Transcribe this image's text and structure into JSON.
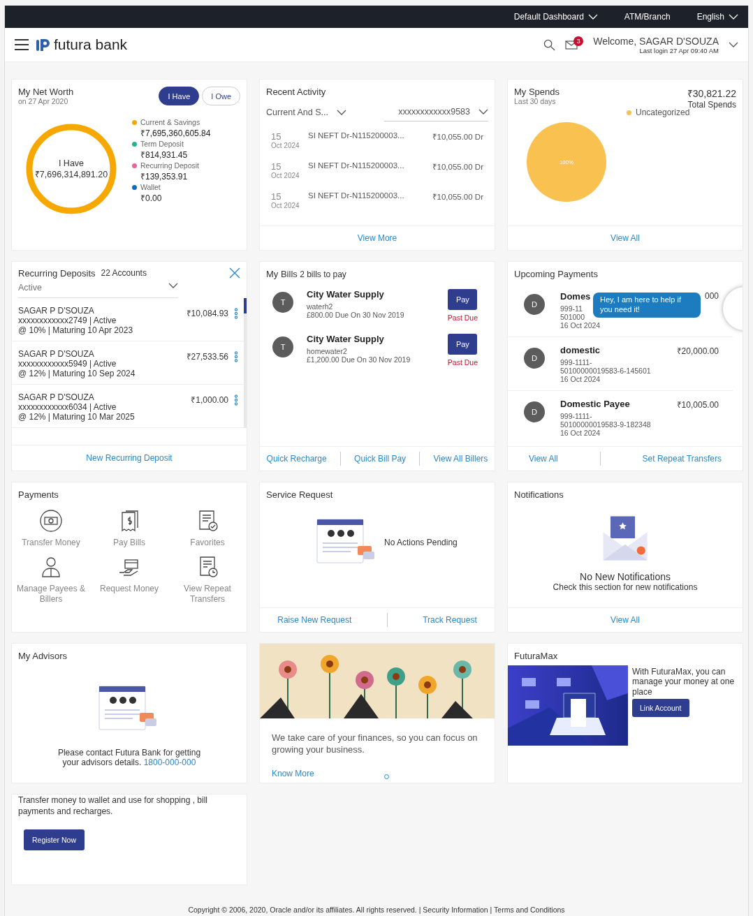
{
  "top_bar": {
    "items": [
      {
        "label": "Default Dashboard",
        "kind": "dropdown"
      },
      {
        "label": "ATM/Branch",
        "kind": "link"
      },
      {
        "label": "English",
        "kind": "dropdown"
      }
    ]
  },
  "header": {
    "brand": "futura bank",
    "notification_count": "3",
    "welcome": "Welcome, SAGAR D'SOUZA",
    "last_login": "Last login 27 Apr 09:40 AM"
  },
  "net_worth": {
    "title": "My Net Worth",
    "date": "on 27 Apr 2020",
    "toggles": [
      {
        "label": "I Have",
        "selected": true
      },
      {
        "label": "I Owe",
        "selected": false
      }
    ],
    "center_label": "I Have",
    "center_value": "₹7,696,314,891.20",
    "legend": [
      {
        "label": "Current & Savings",
        "value": "₹7,695,360,605.84",
        "color": "#f7a800"
      },
      {
        "label": "Term Deposit",
        "value": "₹814,931.45",
        "color": "#1fb58f"
      },
      {
        "label": "Recurring Deposit",
        "value": "₹139,353.91",
        "color": "#f0609e"
      },
      {
        "label": "Wallet",
        "value": "₹0.00",
        "color": "#0a6ac9"
      }
    ]
  },
  "recent_activity": {
    "title": "Recent Activity",
    "filters": [
      "Current And S...",
      "xxxxxxxxxxxx9583"
    ],
    "rows": [
      {
        "day": "15",
        "month_year": "Oct 2024",
        "description": "SI NEFT Dr-N115200003...",
        "amount": "₹10,055.00 Dr"
      },
      {
        "day": "15",
        "month_year": "Oct 2024",
        "description": "SI NEFT Dr-N115200003...",
        "amount": "₹10,055.00 Dr"
      },
      {
        "day": "15",
        "month_year": "Oct 2024",
        "description": "SI NEFT Dr-N115200003...",
        "amount": "₹10,055.00 Dr"
      }
    ],
    "link": "View More"
  },
  "spends": {
    "title": "My Spends",
    "subtitle": "Last 30 days",
    "total": "₹30,821.22",
    "total_label": "Total Spends",
    "legend": [
      {
        "label": "Uncategorized",
        "color": "#f8c150",
        "share": "100%"
      }
    ],
    "link": "View All"
  },
  "recurring_deposits": {
    "title": "Recurring Deposits",
    "count": "22 Accounts",
    "filter": "Active",
    "rows": [
      {
        "name": "SAGAR P D'SOUZA",
        "account": "xxxxxxxxxxxx2749 | Active",
        "terms": "@ 10% | Maturing 10 Apr 2023",
        "amount": "₹10,084.93"
      },
      {
        "name": "SAGAR P D'SOUZA",
        "account": "xxxxxxxxxxxx5949 | Active",
        "terms": "@ 12% | Maturing 10 Sep 2024",
        "amount": "₹27,533.56"
      },
      {
        "name": "SAGAR P D'SOUZA",
        "account": "xxxxxxxxxxxx6034 | Active",
        "terms": "@ 12% | Maturing 10 Mar 2025",
        "amount": "₹1,000.00"
      }
    ],
    "link": "New Recurring Deposit"
  },
  "bills": {
    "title": "My Bills",
    "subtitle": "2 bills to pay",
    "items": [
      {
        "initial": "T",
        "name": "City Water Supply",
        "nickname": "waterh2",
        "due": "£800.00 Due On 30 Nov 2019",
        "button": "Pay",
        "status": "Past Due"
      },
      {
        "initial": "T",
        "name": "City Water Supply",
        "nickname": "homewater2",
        "due": "£1,200.00 Due On 30 Nov 2019",
        "button": "Pay",
        "status": "Past Due"
      }
    ],
    "links": [
      "Quick Recharge",
      "Quick Bill Pay",
      "View All Billers"
    ]
  },
  "upcoming_payments": {
    "title": "Upcoming Payments",
    "rows": [
      {
        "initial": "D",
        "name": "Domes",
        "lines": [
          "999-11",
          "501000",
          "16 Oct 2024"
        ],
        "amount": "000"
      },
      {
        "initial": "D",
        "name": "domestic",
        "lines": [
          "999-1111-",
          "50100000019583-6-145601",
          "16 Oct 2024"
        ],
        "amount": "₹20,000.00"
      },
      {
        "initial": "D",
        "name": "Domestic Payee",
        "lines": [
          "999-1111-",
          "50100000019583-9-182348",
          "16 Oct 2024"
        ],
        "amount": "₹10,005.00"
      }
    ],
    "chat_bubble": "Hey, I am here to help if you need it!",
    "links": [
      "View All",
      "Set Repeat Transfers"
    ]
  },
  "payments": {
    "title": "Payments",
    "items": [
      {
        "label": "Transfer Money",
        "kind": "transfer"
      },
      {
        "label": "Pay Bills",
        "kind": "bill"
      },
      {
        "label": "Favorites",
        "kind": "favorite"
      },
      {
        "label": "Manage Payees & Billers",
        "kind": "payee"
      },
      {
        "label": "Request Money",
        "kind": "request"
      },
      {
        "label": "View Repeat Transfers",
        "kind": "repeat"
      }
    ]
  },
  "service_request": {
    "title": "Service Request",
    "message": "No Actions Pending",
    "links": [
      "Raise New Request",
      "Track Request"
    ]
  },
  "notifications": {
    "title": "Notifications",
    "message": "No New Notifications",
    "hint": "Check this section for new notifications",
    "link": "View All"
  },
  "advisors": {
    "title": "My Advisors",
    "message": "Please contact Futura Bank for getting your advisors details.",
    "phone": "1800-000-000"
  },
  "promo": {
    "text": "We take care of your finances, so you can focus on growing your business.",
    "link": "Know More"
  },
  "futuramax": {
    "title": "FuturaMax",
    "text": "With FuturaMax, you can manage your money at one place",
    "button": "Link Account"
  },
  "wallet": {
    "text": "Transfer money to wallet and use for shopping , bill payments and recharges.",
    "button": "Register Now"
  },
  "footer": {
    "text": "Copyright © 2006, 2020, Oracle and/or its affiliates. All rights reserved. | Security Information | Terms and Conditions"
  }
}
